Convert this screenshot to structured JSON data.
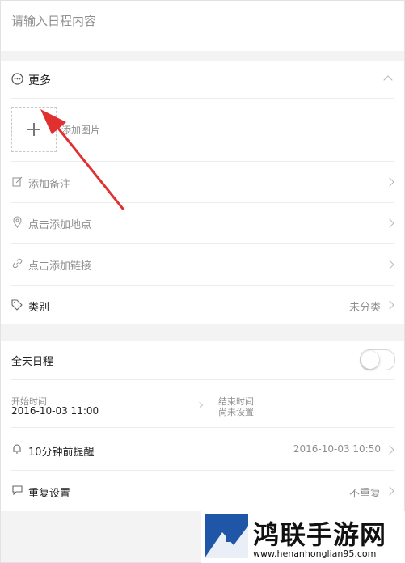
{
  "title_input": {
    "placeholder": "请输入日程内容"
  },
  "more_section": {
    "label": "更多"
  },
  "add_image": {
    "label": "添加图片"
  },
  "items": {
    "note": {
      "label": "添加备注"
    },
    "location": {
      "label": "点击添加地点"
    },
    "link": {
      "label": "点击添加链接"
    },
    "category": {
      "label": "类别",
      "value": "未分类"
    }
  },
  "all_day": {
    "label": "全天日程",
    "enabled": false
  },
  "time": {
    "start_label": "开始时间",
    "start_value": "2016-10-03 11:00",
    "end_label": "结束时间",
    "end_value": "尚未设置"
  },
  "reminder": {
    "label": "10分钟前提醒",
    "value": "2016-10-03 10:50"
  },
  "repeat": {
    "label": "重复设置",
    "value": "不重复"
  },
  "watermark": {
    "brand": "鸿联手游网",
    "url": "www.henanhonglian95.com"
  },
  "colors": {
    "arrow": "#e03030",
    "divider": "#ececec",
    "muted_text": "#8f8f8f",
    "gap": "#f3f3f3"
  }
}
